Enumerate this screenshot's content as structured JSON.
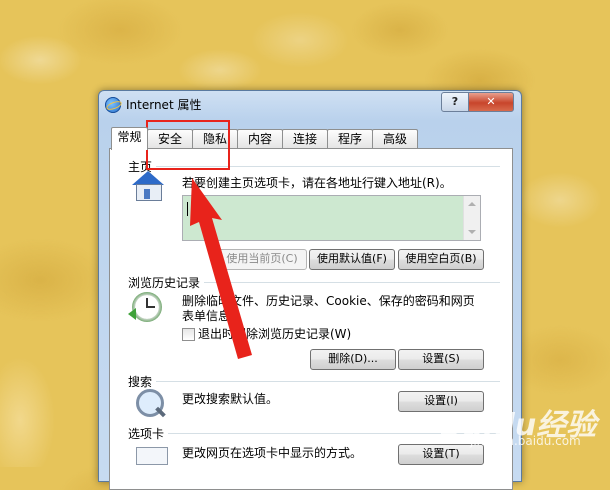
{
  "window": {
    "title": "Internet 属性",
    "help_label": "?",
    "close_label": "✕"
  },
  "tabs": [
    {
      "label": "常规",
      "active": true
    },
    {
      "label": "安全",
      "active": false
    },
    {
      "label": "隐私",
      "active": false
    },
    {
      "label": "内容",
      "active": false
    },
    {
      "label": "连接",
      "active": false
    },
    {
      "label": "程序",
      "active": false
    },
    {
      "label": "高级",
      "active": false
    }
  ],
  "home": {
    "section_title": "主页",
    "description": "若要创建主页选项卡，请在各地址行键入地址(R)。",
    "url_value": "",
    "use_current": "使用当前页(C)",
    "use_default": "使用默认值(F)",
    "use_blank": "使用空白页(B)"
  },
  "history": {
    "section_title": "浏览历史记录",
    "description_line1": "删除临时文件、历史记录、Cookie、保存的密码和网页",
    "description_line2": "表单信息。",
    "checkbox_label": "退出时删除浏览历史记录(W)",
    "checkbox_checked": false,
    "delete_label": "删除(D)...",
    "settings_label": "设置(S)"
  },
  "search": {
    "section_title": "搜索",
    "description": "更改搜索默认值。",
    "settings_label": "设置(I)"
  },
  "tabs_section": {
    "section_title": "选项卡",
    "description": "更改网页在选项卡中显示的方式。",
    "settings_label": "设置(T)"
  },
  "annotation": {
    "color": "#e8231b"
  },
  "watermark": {
    "text": "Baidu经验",
    "url": "jingyan.baidu.com"
  },
  "icons": [
    "ie-icon",
    "house-icon",
    "clock-icon",
    "magnifier-icon",
    "tabs-icon"
  ]
}
